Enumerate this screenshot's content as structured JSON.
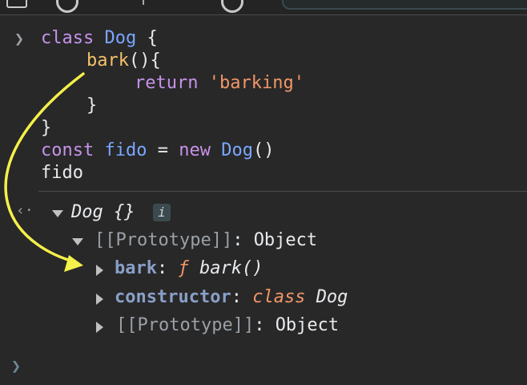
{
  "console": {
    "input_lines": [
      {
        "kw1": "class",
        "name1": "Dog",
        "rest": " {"
      },
      {
        "fn": "bark",
        "rest": "(){"
      },
      {
        "kw": "return",
        "str": "'barking'"
      },
      {
        "rest": "}"
      },
      {
        "rest": "}"
      },
      {
        "kw1": "const",
        "name1": "fido",
        "eq": " = ",
        "kw2": "new",
        "name2": "Dog",
        "rest": "()"
      },
      {
        "rest": "fido"
      }
    ],
    "output": {
      "object_label": "Dog {}",
      "info_icon_text": "i",
      "prototype_label": "[[Prototype]]",
      "prototype_value": "Object",
      "children": [
        {
          "key": "bark",
          "sep": ":",
          "prefix": "ƒ",
          "value": "bark()"
        },
        {
          "key": "constructor",
          "sep": ":",
          "prefix": "class",
          "value": "Dog"
        },
        {
          "key": "[[Prototype]]",
          "sep": ":",
          "value": "Object"
        }
      ]
    },
    "colon": ":"
  },
  "colors": {
    "background": "#282828",
    "keyword": "#c792ea",
    "name": "#7aa6ff",
    "function": "#f5c26b",
    "string": "#f29668",
    "annotation_arrow": "#f5f04a"
  }
}
